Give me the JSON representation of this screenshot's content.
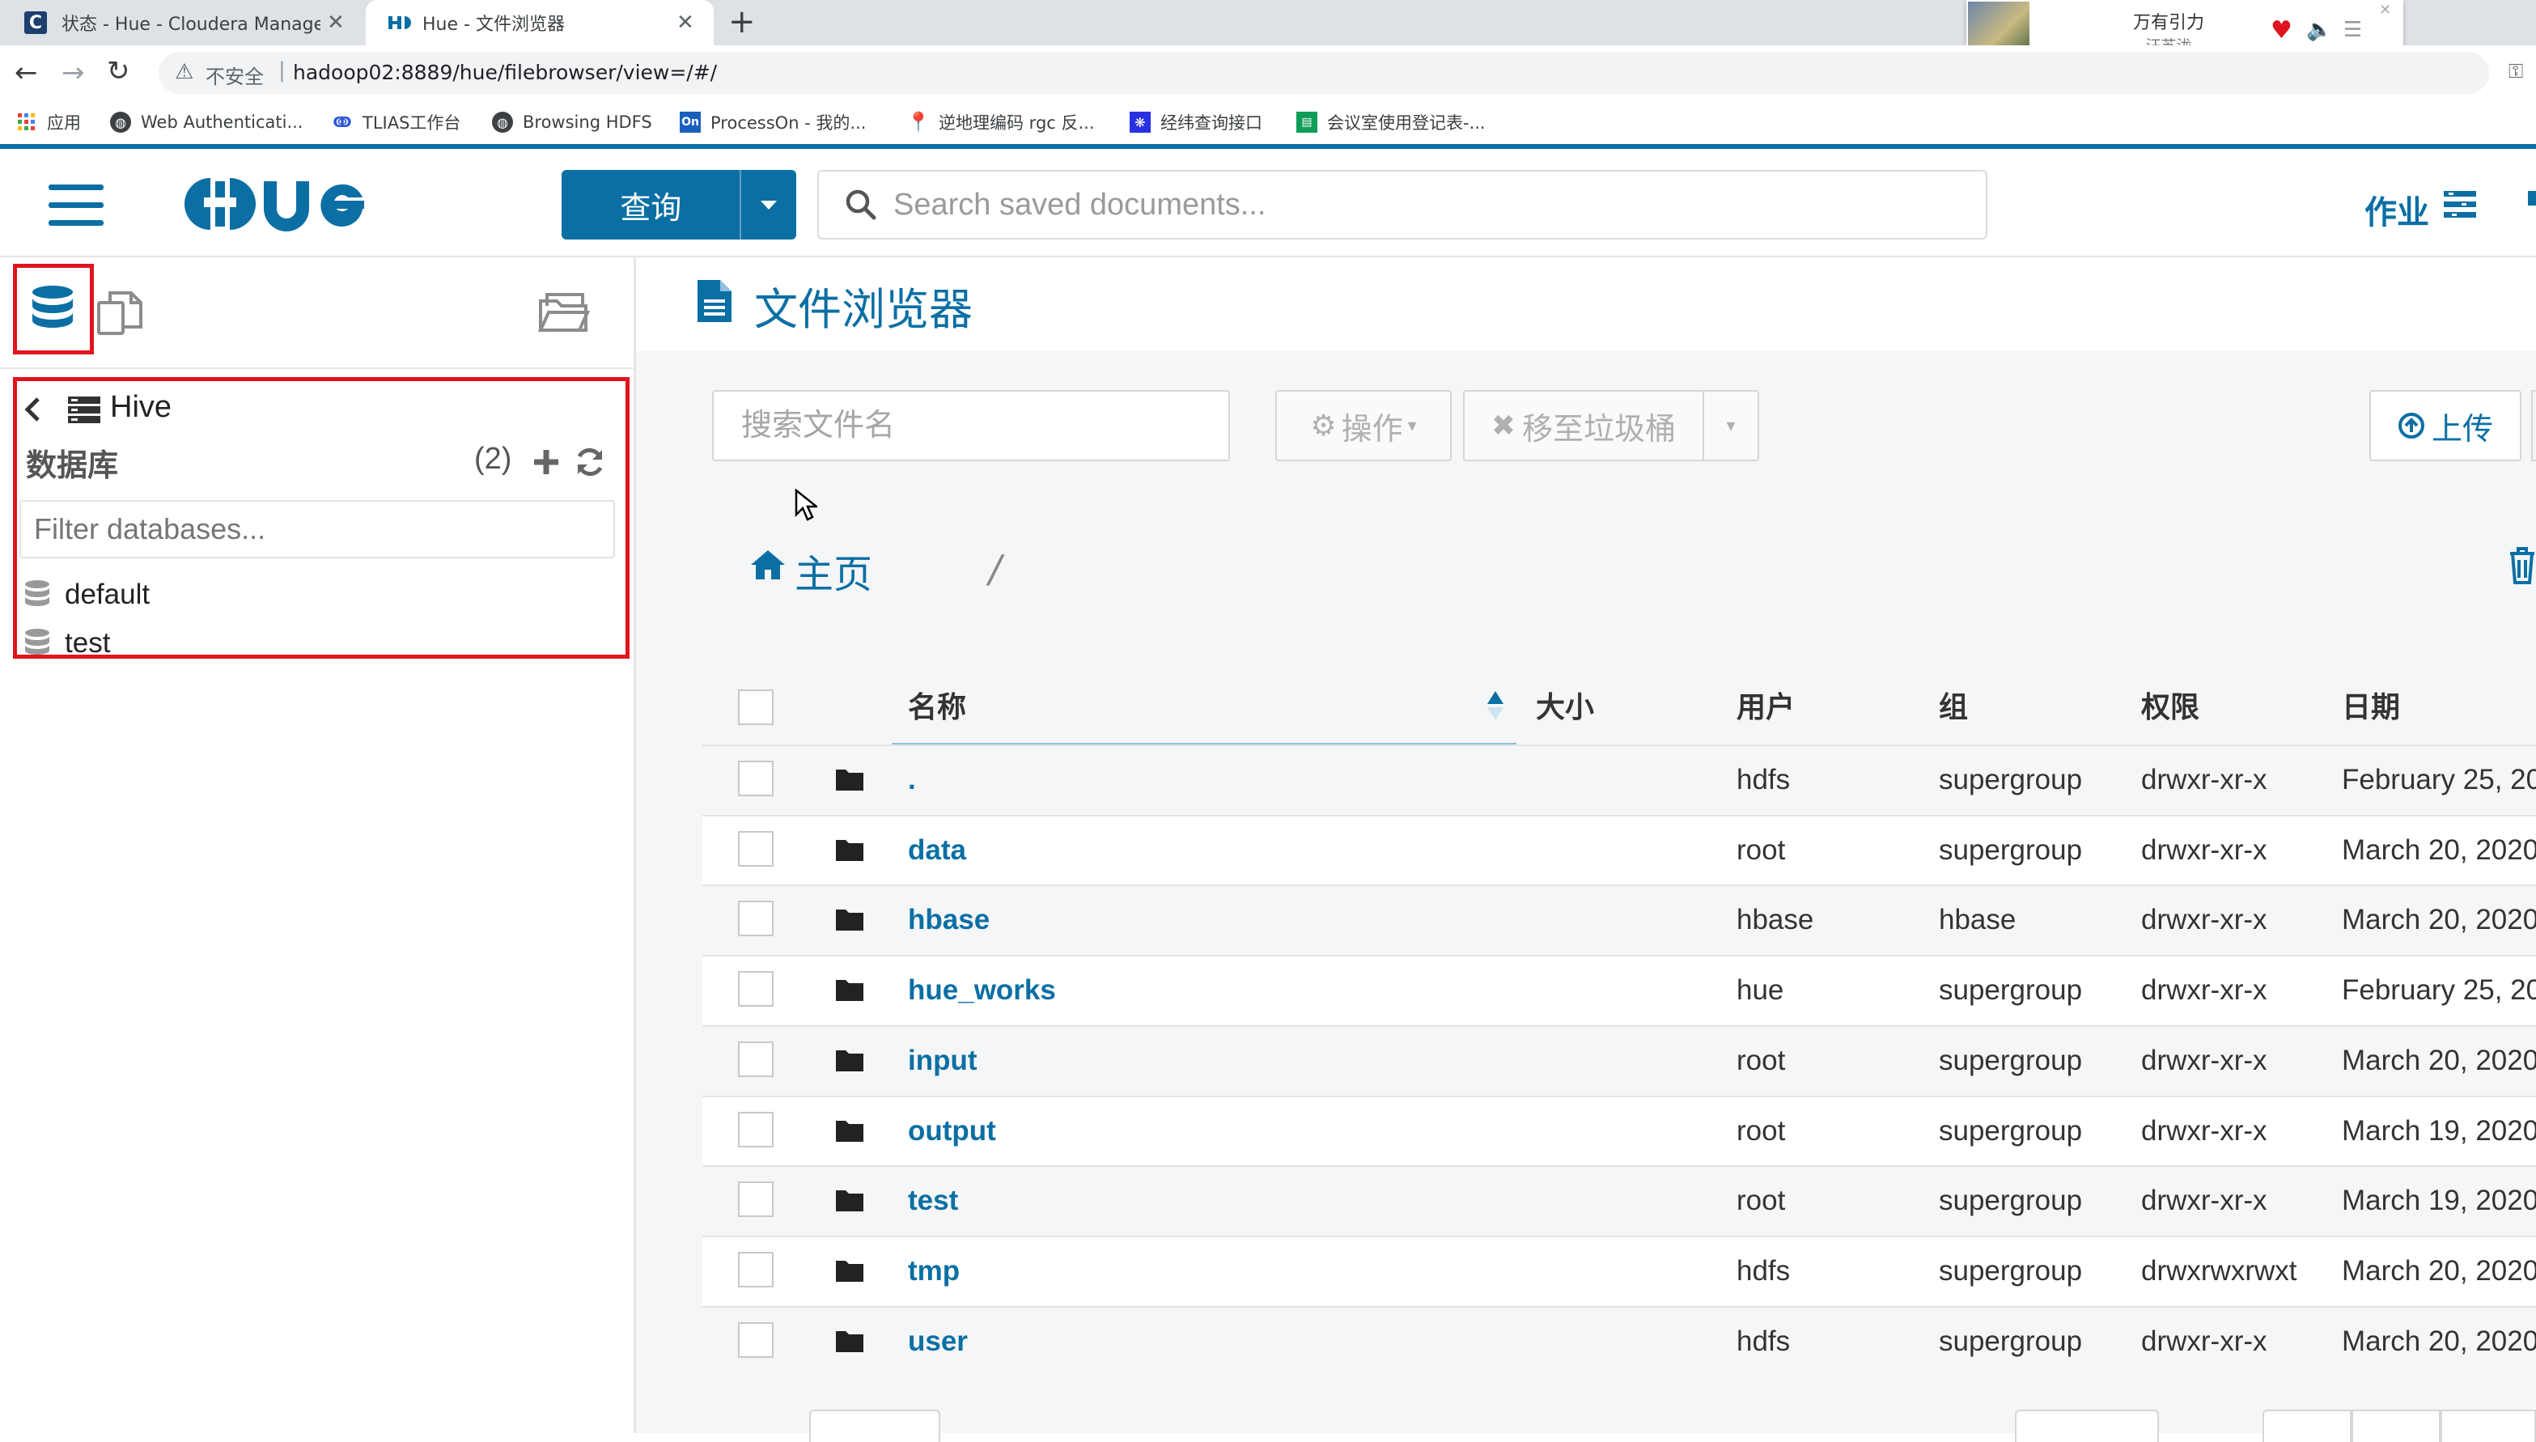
{
  "browser": {
    "tabs": [
      {
        "title": "状态 - Hue - Cloudera Manage",
        "favicon": "C"
      },
      {
        "title": "Hue - 文件浏览器"
      }
    ],
    "new_tab": "+",
    "url_warning": "不安全",
    "url": "hadoop02:8889/hue/filebrowser/view=/#/",
    "bookmarks": [
      {
        "label": "应用",
        "icon": "apps-grid-icon"
      },
      {
        "label": "Web Authenticati...",
        "icon": "globe-icon"
      },
      {
        "label": "TLIAS工作台",
        "icon": "swirl-logo-icon"
      },
      {
        "label": "Browsing HDFS",
        "icon": "globe-icon"
      },
      {
        "label": "ProcessOn - 我的...",
        "icon": "processon-icon"
      },
      {
        "label": "逆地理编码 rgc 反...",
        "icon": "map-pin-icon"
      },
      {
        "label": "经纬查询接口",
        "icon": "baidu-paw-icon"
      },
      {
        "label": "会议室使用登记表-...",
        "icon": "sheet-icon"
      }
    ]
  },
  "media": {
    "title": "万有引力",
    "artist": "汪苏泷"
  },
  "hue": {
    "logo": "HUE",
    "query_label": "查询",
    "search_placeholder": "Search saved documents...",
    "jobs_label": "作业"
  },
  "left": {
    "source": "Hive",
    "db_heading": "数据库",
    "db_count": "(2)",
    "filter_placeholder": "Filter databases...",
    "databases": [
      "default",
      "test"
    ]
  },
  "filebrowser": {
    "title": "文件浏览器",
    "search_placeholder": "搜索文件名",
    "actions_label": "操作",
    "trash_label": "移至垃圾桶",
    "upload_label": "上传",
    "home_label": "主页",
    "path_sep": "/",
    "columns": {
      "name": "名称",
      "size": "大小",
      "user": "用户",
      "group": "组",
      "perm": "权限",
      "date": "日期"
    },
    "rows": [
      {
        "name": ".",
        "size": "",
        "user": "hdfs",
        "group": "supergroup",
        "perm": "drwxr-xr-x",
        "date": "February 25, 20"
      },
      {
        "name": "data",
        "size": "",
        "user": "root",
        "group": "supergroup",
        "perm": "drwxr-xr-x",
        "date": "March 20, 2020"
      },
      {
        "name": "hbase",
        "size": "",
        "user": "hbase",
        "group": "hbase",
        "perm": "drwxr-xr-x",
        "date": "March 20, 2020"
      },
      {
        "name": "hue_works",
        "size": "",
        "user": "hue",
        "group": "supergroup",
        "perm": "drwxr-xr-x",
        "date": "February 25, 20"
      },
      {
        "name": "input",
        "size": "",
        "user": "root",
        "group": "supergroup",
        "perm": "drwxr-xr-x",
        "date": "March 20, 2020"
      },
      {
        "name": "output",
        "size": "",
        "user": "root",
        "group": "supergroup",
        "perm": "drwxr-xr-x",
        "date": "March 19, 2020"
      },
      {
        "name": "test",
        "size": "",
        "user": "root",
        "group": "supergroup",
        "perm": "drwxr-xr-x",
        "date": "March 19, 2020"
      },
      {
        "name": "tmp",
        "size": "",
        "user": "hdfs",
        "group": "supergroup",
        "perm": "drwxrwxrwxt",
        "date": "March 20, 2020"
      },
      {
        "name": "user",
        "size": "",
        "user": "hdfs",
        "group": "supergroup",
        "perm": "drwxr-xr-x",
        "date": "March 20, 2020"
      }
    ]
  },
  "colors": {
    "brand": "#0b6fa4",
    "highlight": "#e0141e"
  }
}
